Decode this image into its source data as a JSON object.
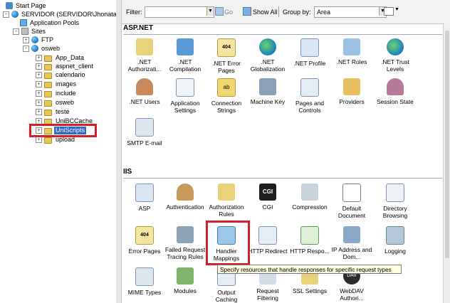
{
  "tree": {
    "start_page": "Start Page",
    "server": "SERVIDOR (SERVIDOR\\Jhonata)",
    "app_pools": "Application Pools",
    "sites": "Sites",
    "ftp": "FTP",
    "osweb": "osweb",
    "children": [
      "App_Data",
      "aspnet_client",
      "calendario",
      "images",
      "include",
      "osweb",
      "teste",
      "UniBCCache",
      "UniScripts",
      "upload"
    ]
  },
  "toolbar": {
    "filter_label": "Filter:",
    "go_label": "Go",
    "show_all_label": "Show All",
    "group_by_label": "Group by:",
    "group_by_value": "Area"
  },
  "sections": {
    "aspnet": "ASP.NET",
    "iis": "IIS"
  },
  "aspnet_items": [
    ".NET Authorizati...",
    ".NET Compilation",
    ".NET Error Pages",
    ".NET Globalization",
    ".NET Profile",
    ".NET Roles",
    ".NET Trust Levels",
    ".NET Users",
    "Application Settings",
    "Connection Strings",
    "Machine Key",
    "Pages and Controls",
    "Providers",
    "Session State",
    "SMTP E-mail"
  ],
  "iis_items": [
    "ASP",
    "Authentication",
    "Authorization Rules",
    "CGI",
    "Compression",
    "Default Document",
    "Directory Browsing",
    "Error Pages",
    "Failed Request Tracing Rules",
    "Handler Mappings",
    "HTTP Redirect",
    "HTTP Respo...",
    "IP Address and Dom...",
    "Logging",
    "MIME Types",
    "Modules",
    "Output Caching",
    "Request Filtering",
    "SSL Settings",
    "WebDAV Authori..."
  ],
  "tooltip": "Specify resources that handle responses for specific request types",
  "icon_texts": {
    "error_404": "404",
    "cgi": "CGI",
    "ab": "ab",
    "dav": "DAV"
  }
}
